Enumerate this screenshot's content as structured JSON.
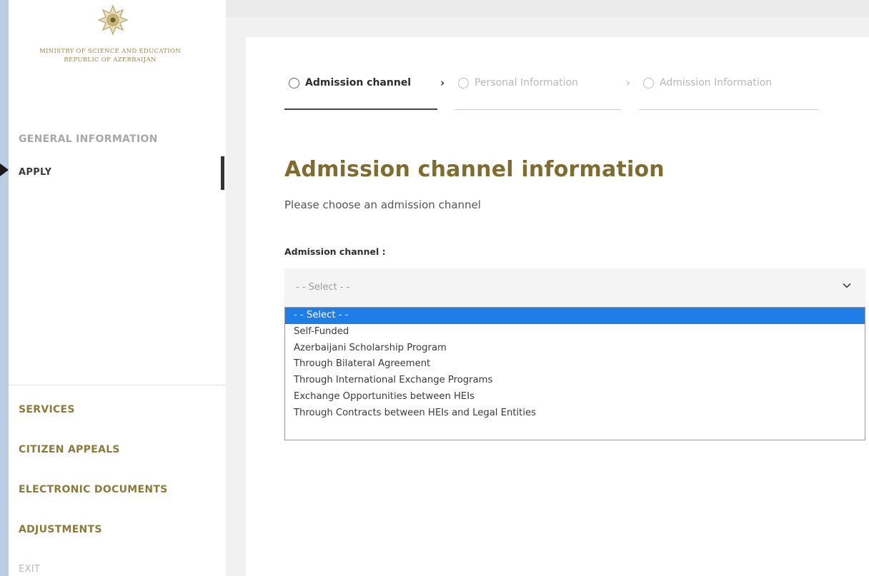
{
  "sidebar": {
    "ministry_line1": "Ministry of Science and Education",
    "ministry_line2": "Republic of Azerbaijan",
    "nav": {
      "general_information": "GENERAL INFORMATION",
      "apply": "APPLY",
      "services": "SERVICES",
      "citizen_appeals": "CITIZEN APPEALS",
      "electronic_documents": "ELECTRONIC DOCUMENTS",
      "adjustments": "ADJUSTMENTS",
      "exit": "EXIT"
    }
  },
  "steps": [
    {
      "label": "Admission channel",
      "state": "active"
    },
    {
      "label": "Personal Information",
      "state": "inactive"
    },
    {
      "label": "Admission Information",
      "state": "inactive"
    }
  ],
  "main": {
    "heading": "Admission channel information",
    "subtitle": "Please choose an admission channel",
    "field_label": "Admission channel :",
    "select_value": "- - Select - -",
    "options": [
      "- - Select - -",
      "Self-Funded",
      "Azerbaijani Scholarship Program",
      "Through Bilateral Agreement",
      "Through International Exchange Programs",
      "Exchange Opportunities between HEIs",
      "Through Contracts between HEIs and Legal Entities"
    ],
    "highlighted_option_index": 0
  },
  "colors": {
    "accent_gold": "#7f6c2e",
    "highlight_blue": "#1f7de8",
    "frame_blue": "#b9cde3"
  },
  "icons": {
    "emblem": "state-emblem-icon",
    "step_marker": "circle-icon",
    "step_separator": "chevron-right-icon",
    "select_toggle": "chevron-down-icon",
    "current_page_marker": "arrow-right-icon"
  }
}
